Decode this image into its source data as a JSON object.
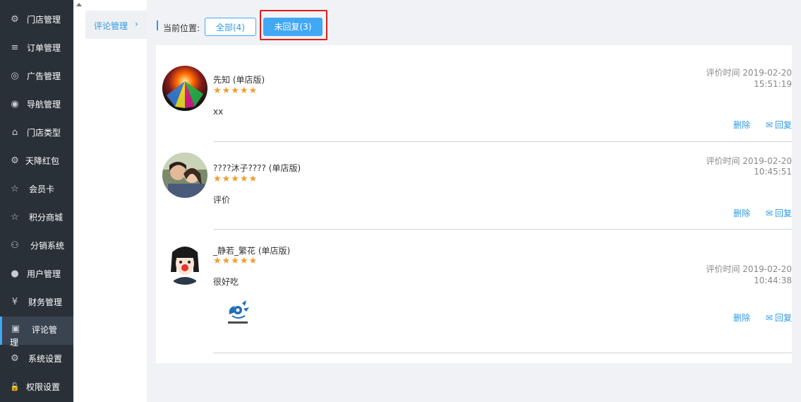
{
  "sidebar": {
    "items": [
      {
        "label": "门店管理",
        "icon": "stores-icon",
        "glyph": "⚙"
      },
      {
        "label": "订单管理",
        "icon": "list-icon",
        "glyph": "≡"
      },
      {
        "label": "广告管理",
        "icon": "lifebuoy-icon",
        "glyph": "◎"
      },
      {
        "label": "导航管理",
        "icon": "compass-icon",
        "glyph": "◉"
      },
      {
        "label": "门店类型",
        "icon": "bank-icon",
        "glyph": "⌂"
      },
      {
        "label": "天降红包",
        "icon": "coins-icon",
        "glyph": "⚙"
      },
      {
        "label": "会员卡",
        "icon": "star-icon",
        "glyph": "☆"
      },
      {
        "label": "积分商城",
        "icon": "star-icon",
        "glyph": "☆"
      },
      {
        "label": "分销系统",
        "icon": "users-icon",
        "glyph": "⚇"
      },
      {
        "label": "用户管理",
        "icon": "user-icon",
        "glyph": "●"
      },
      {
        "label": "财务管理",
        "icon": "yen-icon",
        "glyph": "¥"
      },
      {
        "label": "评论管理",
        "icon": "money-icon",
        "glyph": "▣"
      },
      {
        "label": "系统设置",
        "icon": "gear-icon",
        "glyph": "⚙"
      },
      {
        "label": "权限设置",
        "icon": "unlock-icon",
        "glyph": "🔓"
      }
    ]
  },
  "submenu": {
    "label": "评论管理",
    "chevron": "›"
  },
  "topbar": {
    "location_label": "当前位置:",
    "tab_all": "全部(4)",
    "tab_unreplied": "未回复(3)"
  },
  "reviews": [
    {
      "name": "先知 (单店版)",
      "stars": "★★★★★",
      "comment": "xx",
      "time_label": "评价时间 2019-02-20",
      "time": "15:51:19",
      "delete": "删除",
      "reply": "回复"
    },
    {
      "name": "????沐子???? (单店版)",
      "stars": "★★★★★",
      "comment": "评价",
      "time_label": "评价时间 2019-02-20",
      "time": "10:45:51",
      "delete": "删除",
      "reply": "回复"
    },
    {
      "name": "_静若_繁花 (单店版)",
      "stars": "★★★★★",
      "comment": "很好吃",
      "time_label": "评价时间 2019-02-20",
      "time": "10:44:38",
      "delete": "删除",
      "reply": "回复"
    }
  ],
  "colors": {
    "accent": "#41a8f5",
    "sidebar": "#293038",
    "star": "#f39c2b",
    "highlight": "#e41b1b"
  }
}
